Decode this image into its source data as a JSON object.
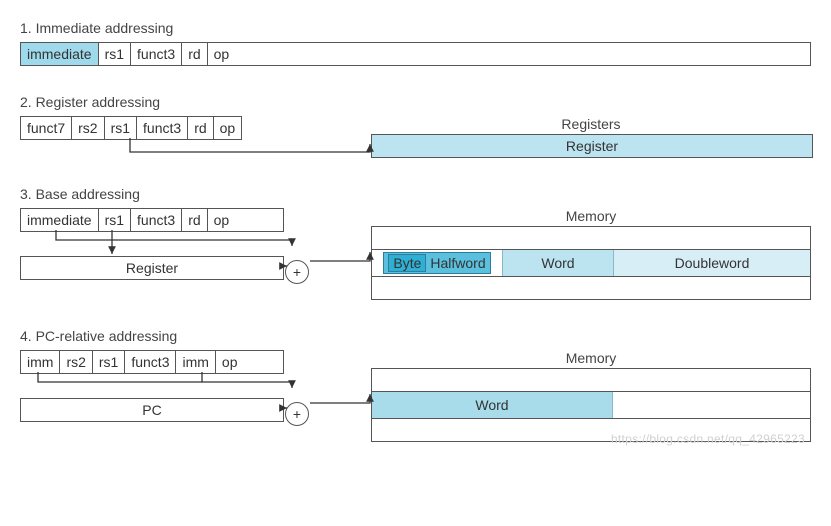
{
  "sections": {
    "immediate": {
      "title": "1.  Immediate addressing",
      "fields": [
        "immediate",
        "rs1",
        "funct3",
        "rd",
        "op"
      ]
    },
    "register": {
      "title": "2. Register addressing",
      "fields": [
        "funct7",
        "rs2",
        "rs1",
        "funct3",
        "rd",
        "op"
      ],
      "target_label": "Registers",
      "target_value": "Register"
    },
    "base": {
      "title": "3.  Base addressing",
      "fields": [
        "immediate",
        "rs1",
        "funct3",
        "rd",
        "op"
      ],
      "lower_box": "Register",
      "adder": "+",
      "mem_label": "Memory",
      "mem_cells": {
        "byte": "Byte",
        "halfword": "Halfword",
        "word": "Word",
        "doubleword": "Doubleword"
      }
    },
    "pcrel": {
      "title": "4.  PC-relative addressing",
      "fields": [
        "imm",
        "rs2",
        "rs1",
        "funct3",
        "imm",
        "op"
      ],
      "lower_box": "PC",
      "adder": "+",
      "mem_label": "Memory",
      "mem_word": "Word"
    }
  },
  "watermark": "https://blog.csdn.net/qq_42965223"
}
